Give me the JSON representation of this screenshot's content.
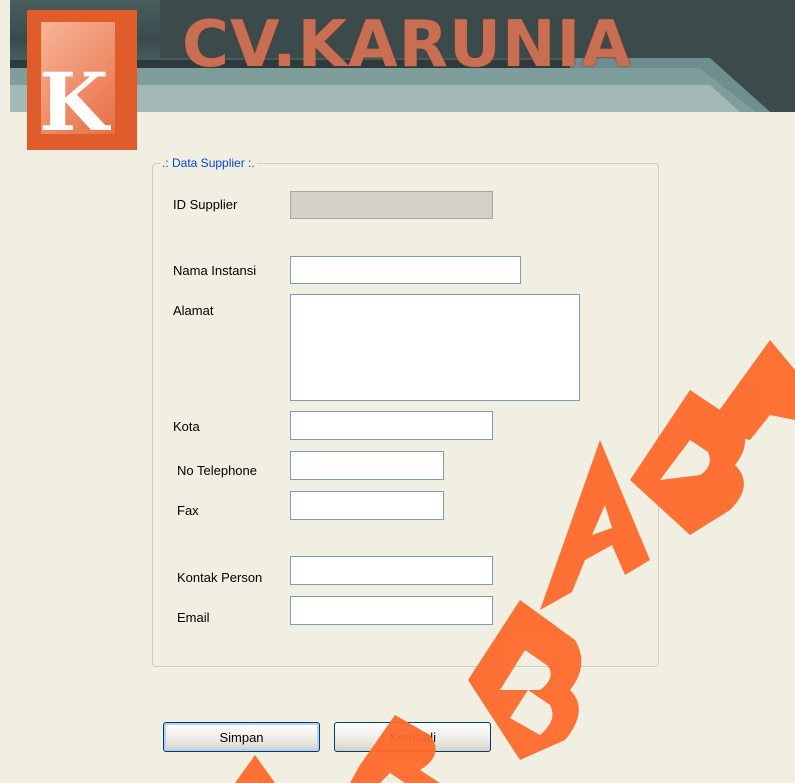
{
  "header": {
    "brand_text": "CV.KARUNIA",
    "logo_letter": "K"
  },
  "form": {
    "group_title": ".: Data Supplier :.",
    "fields": {
      "id_supplier": {
        "label": "ID Supplier",
        "value": ""
      },
      "nama_instansi": {
        "label": "Nama Instansi",
        "value": ""
      },
      "alamat": {
        "label": "Alamat",
        "value": ""
      },
      "kota": {
        "label": "Kota",
        "value": ""
      },
      "no_telephone": {
        "label": "No Telephone",
        "value": ""
      },
      "fax": {
        "label": "Fax",
        "value": ""
      },
      "kontak_person": {
        "label": "Kontak Person",
        "value": ""
      },
      "email": {
        "label": "Email",
        "value": ""
      }
    }
  },
  "buttons": {
    "simpan": "Simpan",
    "kembali": "Kembali"
  },
  "colors": {
    "background": "#f1efe2",
    "group_title": "#0046d5",
    "watermark": "#ff6a2b",
    "logo": "#e05c2a"
  }
}
